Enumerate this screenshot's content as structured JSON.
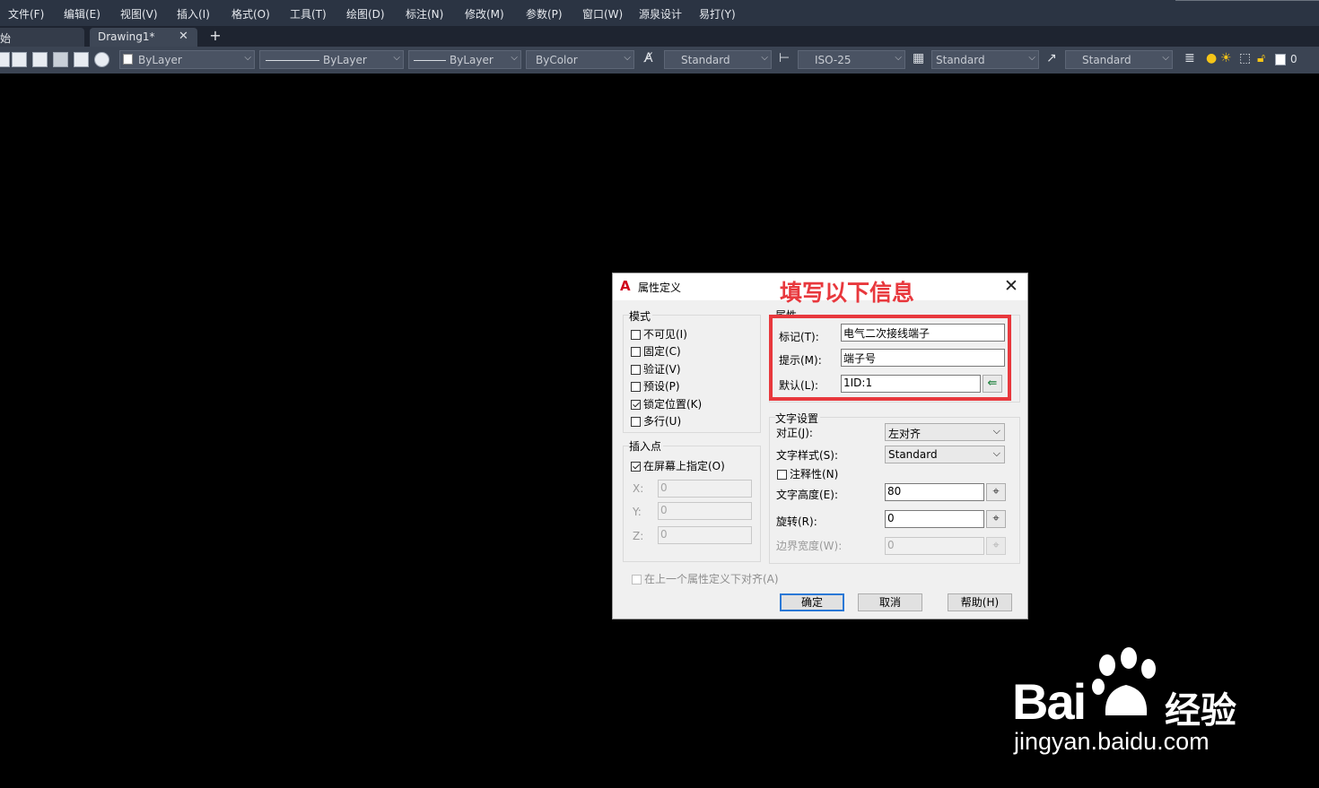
{
  "menu": {
    "items": [
      "文件(F)",
      "编辑(E)",
      "视图(V)",
      "插入(I)",
      "格式(O)",
      "工具(T)",
      "绘图(D)",
      "标注(N)",
      "修改(M)",
      "参数(P)",
      "窗口(W)",
      "源泉设计",
      "易打(Y)"
    ]
  },
  "tabs": {
    "start_label": "始",
    "drawing_label": "Drawing1*",
    "close_glyph": "✕",
    "add_glyph": "+"
  },
  "toolbar": {
    "color_select": "ByLayer",
    "linetype_select": "ByLayer",
    "lineweight_select": "ByLayer",
    "plotstyle_select": "ByColor",
    "text_style": "Standard",
    "dim_style": "ISO-25",
    "table_style": "Standard",
    "mleader_style": "Standard",
    "layer_value": "0"
  },
  "dialog": {
    "title": "属性定义",
    "annotation": "填写以下信息",
    "mode": {
      "title": "模式",
      "options": [
        {
          "label": "不可见(I)",
          "checked": false
        },
        {
          "label": "固定(C)",
          "checked": false
        },
        {
          "label": "验证(V)",
          "checked": false
        },
        {
          "label": "预设(P)",
          "checked": false
        },
        {
          "label": "锁定位置(K)",
          "checked": true
        },
        {
          "label": "多行(U)",
          "checked": false
        }
      ]
    },
    "attribute": {
      "title": "属性",
      "tag_label": "标记(T):",
      "tag_value": "电气二次接线端子",
      "prompt_label": "提示(M):",
      "prompt_value": "端子号",
      "default_label": "默认(L):",
      "default_value": "1ID:1"
    },
    "insertion": {
      "title": "插入点",
      "specify_on_screen": "在屏幕上指定(O)",
      "specify_checked": true,
      "x_label": "X:",
      "x_value": "0",
      "y_label": "Y:",
      "y_value": "0",
      "z_label": "Z:",
      "z_value": "0"
    },
    "text_settings": {
      "title": "文字设置",
      "justify_label": "对正(J):",
      "justify_value": "左对齐",
      "style_label": "文字样式(S):",
      "style_value": "Standard",
      "annotative_label": "注释性(N)",
      "height_label": "文字高度(E):",
      "height_value": "80",
      "rotation_label": "旋转(R):",
      "rotation_value": "0",
      "boundary_label": "边界宽度(W):",
      "boundary_value": "0"
    },
    "align_below": "在上一个属性定义下对齐(A)",
    "buttons": {
      "ok": "确定",
      "cancel": "取消",
      "help": "帮助(H)"
    }
  },
  "watermark": {
    "brand": "Bai",
    "brand_cn": "经验",
    "url": "jingyan.baidu.com"
  },
  "colors": {
    "menubar_bg": "#2b3443",
    "toolbar_bg": "#3b4453",
    "canvas_bg": "#000000",
    "annotation_red": "#e8383d",
    "ok_border": "#2a78d6"
  }
}
